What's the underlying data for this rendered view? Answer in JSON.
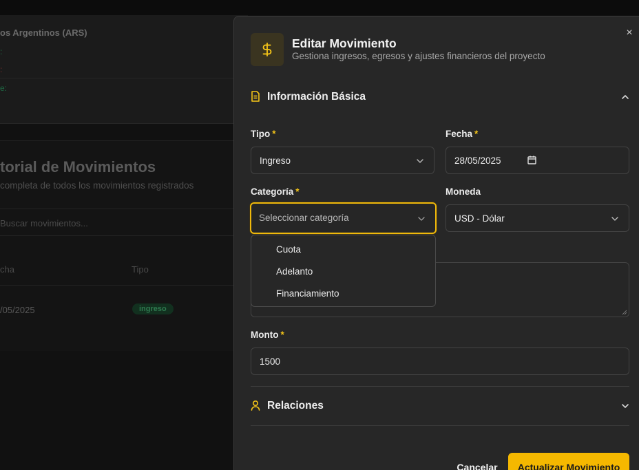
{
  "background": {
    "currency_title": "os Argentinos (ARS)",
    "dots": [
      ":",
      ":",
      "e:"
    ],
    "history_title": "torial de Movimientos",
    "history_subtitle": "completa de todos los movimientos registrados",
    "search_placeholder": "Buscar movimientos...",
    "table": {
      "headers": [
        "cha",
        "Tipo"
      ],
      "rows": [
        {
          "fecha": "/05/2025",
          "tipo": "ingreso"
        }
      ]
    }
  },
  "modal": {
    "icon": "dollar-icon",
    "title": "Editar Movimiento",
    "subtitle": "Gestiona ingresos, egresos y ajustes financieros del proyecto",
    "close_symbol": "×",
    "section_basic": {
      "label": "Información Básica",
      "icon": "document-icon",
      "expanded": true
    },
    "fields": {
      "tipo": {
        "label": "Tipo",
        "required": "*",
        "value": "Ingreso"
      },
      "fecha": {
        "label": "Fecha",
        "required": "*",
        "value": "28/05/2025"
      },
      "categoria": {
        "label": "Categoría",
        "required": "*",
        "placeholder": "Seleccionar categoría"
      },
      "moneda": {
        "label": "Moneda",
        "value": "USD - Dólar"
      },
      "monto": {
        "label": "Monto",
        "required": "*",
        "value": "1500"
      }
    },
    "categoria_options": [
      "Cuota",
      "Adelanto",
      "Financiamiento"
    ],
    "section_relaciones": {
      "label": "Relaciones",
      "icon": "user-icon",
      "expanded": false
    },
    "buttons": {
      "cancel": "Cancelar",
      "submit": "Actualizar Movimiento"
    }
  },
  "colors": {
    "accent": "#f5b800",
    "background": "#0f0f0f",
    "modal": "#272727"
  }
}
